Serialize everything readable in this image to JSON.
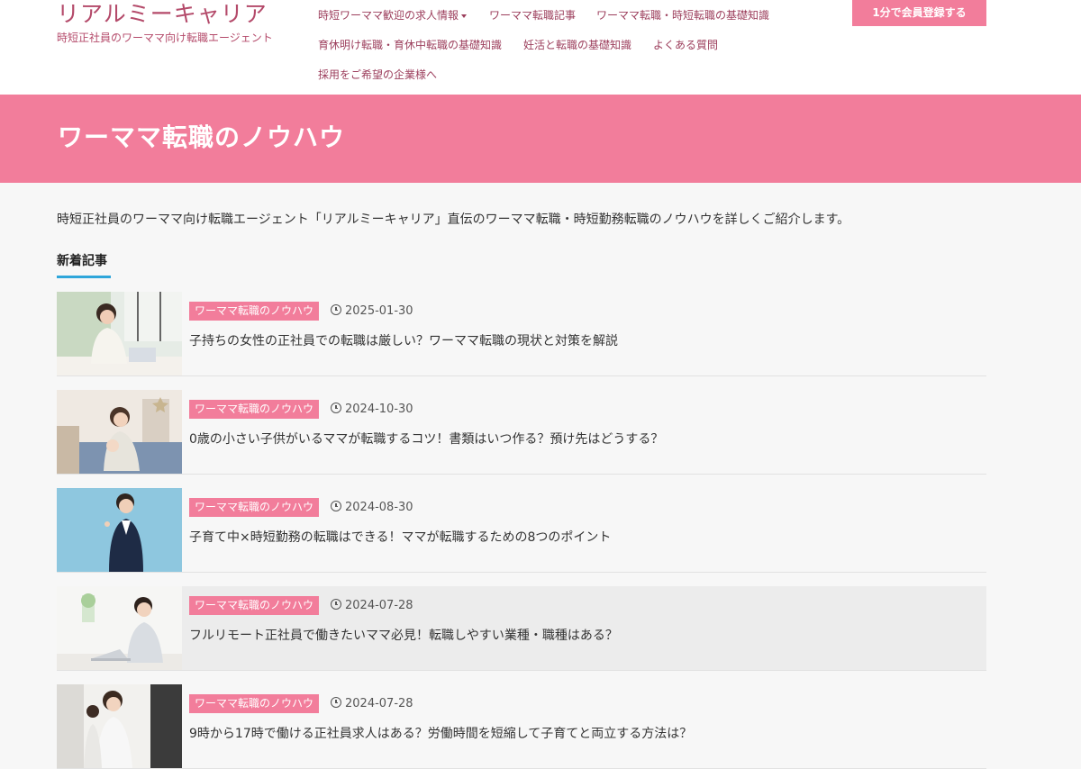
{
  "header": {
    "logo": "リアルミーキャリア",
    "tagline": "時短正社員のワーママ向け転職エージェント",
    "nav": [
      {
        "label": "時短ワーママ歓迎の求人情報"
      },
      {
        "label": "ワーママ転職記事"
      },
      {
        "label": "ワーママ転職・時短転職の基礎知識"
      },
      {
        "label": "育休明け転職・育休中転職の基礎知識"
      },
      {
        "label": "妊活と転職の基礎知識"
      },
      {
        "label": "よくある質問"
      },
      {
        "label": "採用をご希望の企業様へ"
      }
    ],
    "cta": "1分で会員登録する"
  },
  "banner": {
    "title": "ワーママ転職のノウハウ"
  },
  "main": {
    "intro": "時短正社員のワーママ向け転職エージェント「リアルミーキャリア」直伝のワーママ転職・時短勤務転職のノウハウを詳しくご紹介します。",
    "section_title": "新着記事",
    "articles": [
      {
        "category": "ワーママ転職のノウハウ",
        "date": "2025-01-30",
        "title": "子持ちの女性の正社員での転職は厳しい？ワーママ転職の現状と対策を解説"
      },
      {
        "category": "ワーママ転職のノウハウ",
        "date": "2024-10-30",
        "title": "0歳の小さい子供がいるママが転職するコツ！書類はいつ作る？預け先はどうする？"
      },
      {
        "category": "ワーママ転職のノウハウ",
        "date": "2024-08-30",
        "title": "子育て中×時短勤務の転職はできる！ママが転職するための8つのポイント"
      },
      {
        "category": "ワーママ転職のノウハウ",
        "date": "2024-07-28",
        "title": "フルリモート正社員で働きたいママ必見！転職しやすい業種・職種はある？"
      },
      {
        "category": "ワーママ転職のノウハウ",
        "date": "2024-07-28",
        "title": "9時から17時で働ける正社員求人はある？労働時間を短縮して子育てと両立する方法は？"
      }
    ]
  },
  "colors": {
    "accent": "#f27d9b",
    "brand_text": "#b44a6a",
    "underline": "#2fa6da"
  }
}
